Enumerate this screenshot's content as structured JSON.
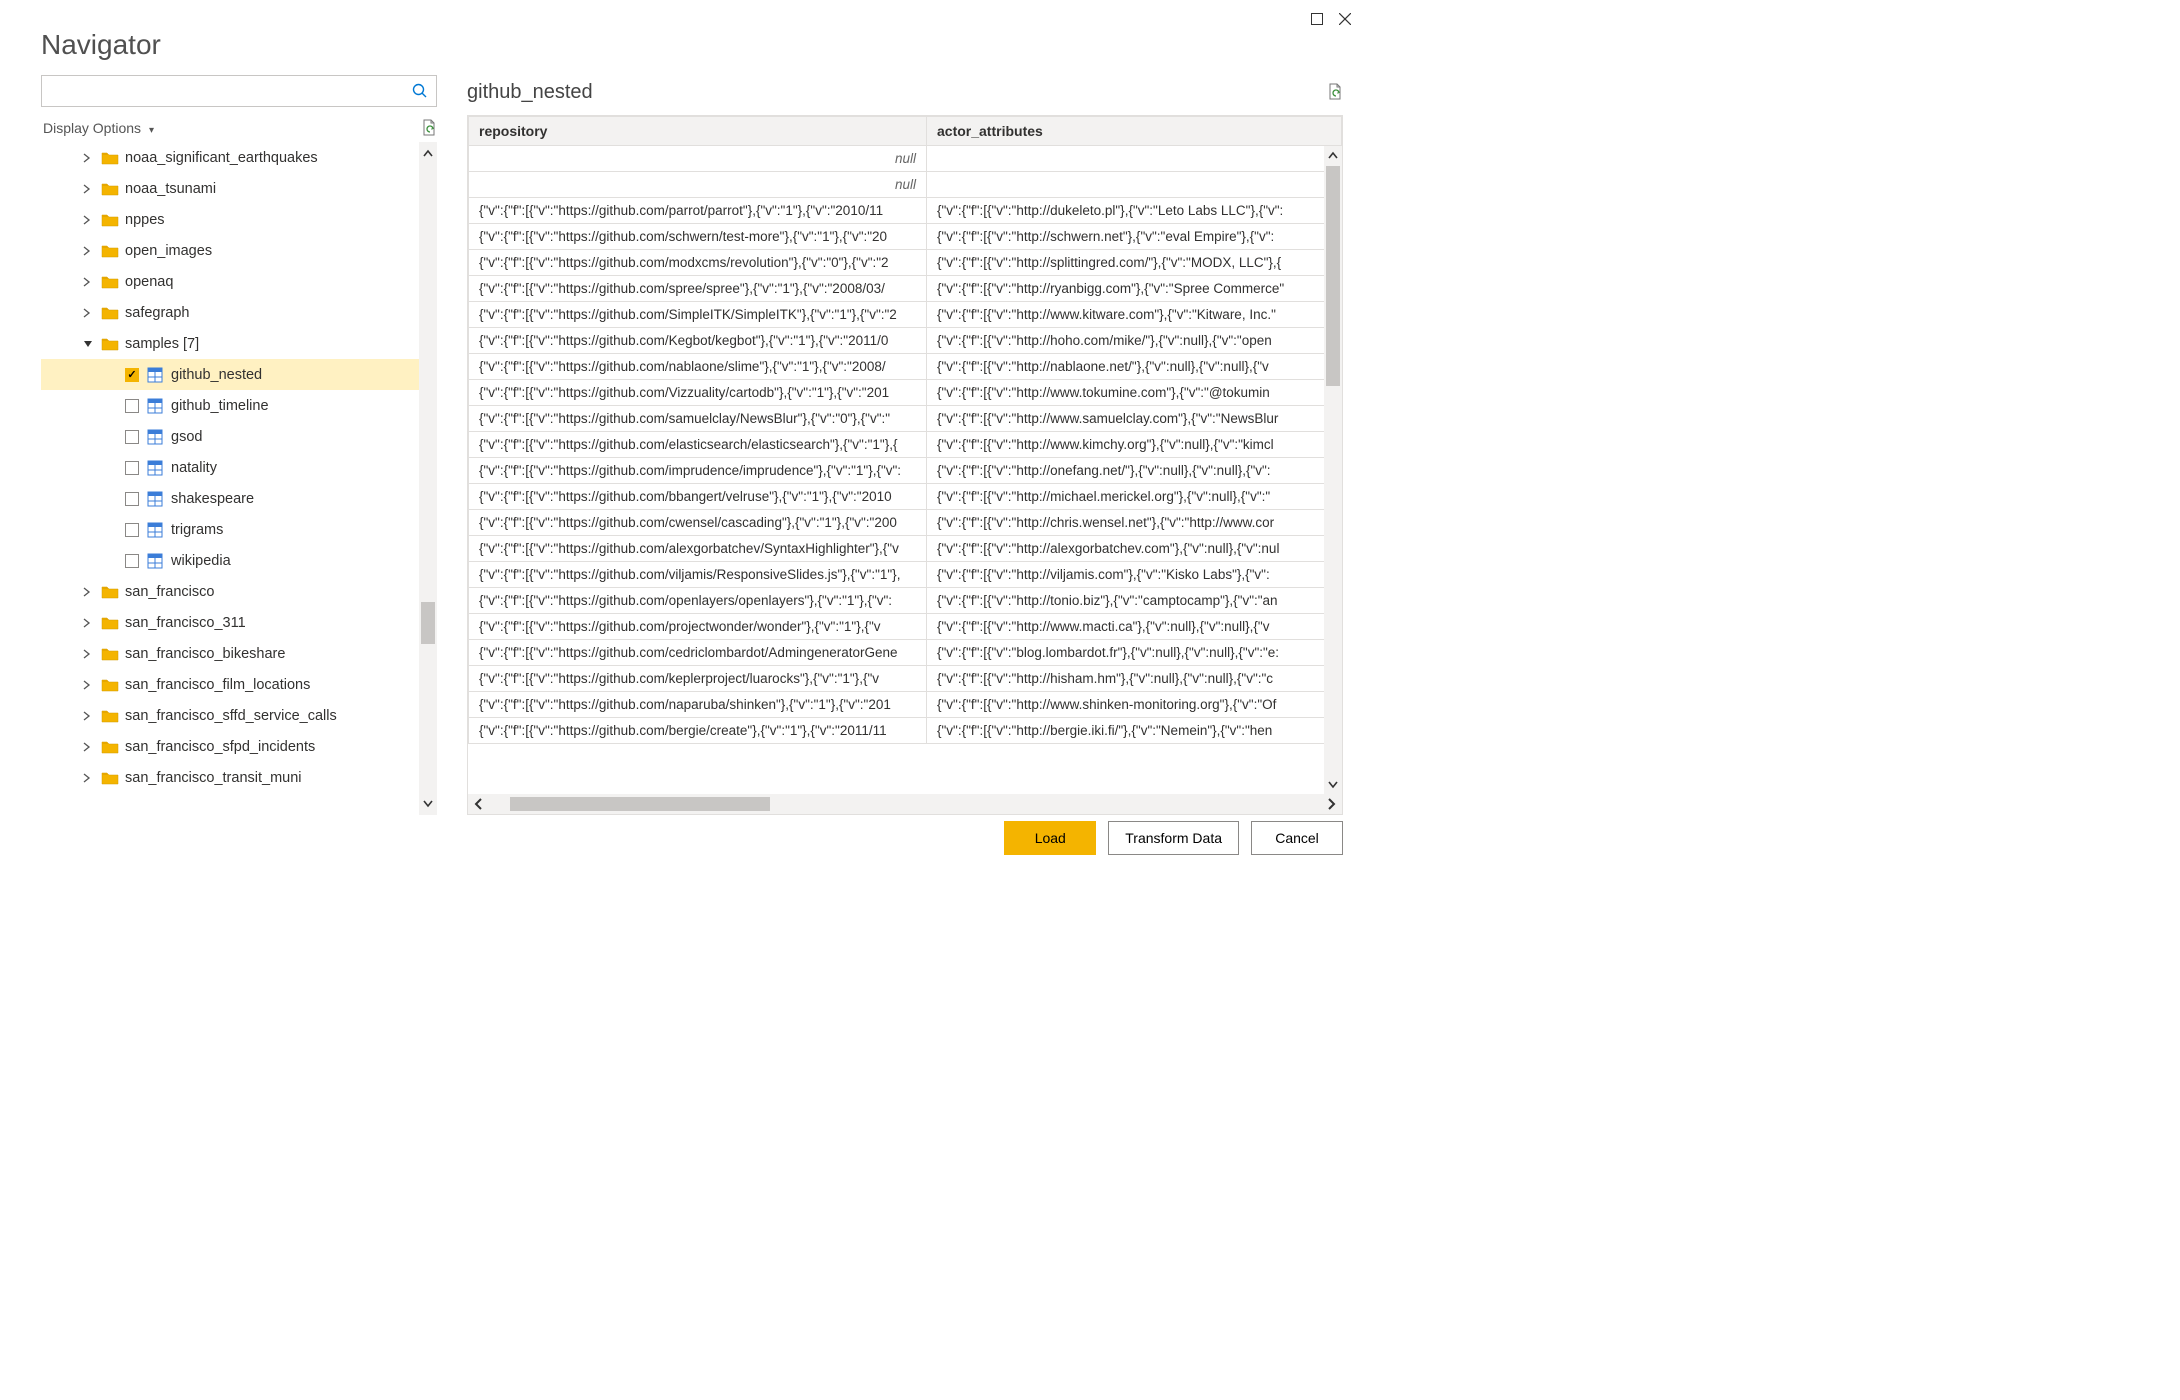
{
  "window": {
    "title": "Navigator"
  },
  "search": {
    "placeholder": ""
  },
  "displayOptions": {
    "label": "Display Options"
  },
  "tree": {
    "items": [
      {
        "type": "folder",
        "level": 1,
        "label": "noaa_significant_earthquakes",
        "truncated": true
      },
      {
        "type": "folder",
        "level": 1,
        "label": "noaa_tsunami"
      },
      {
        "type": "folder",
        "level": 1,
        "label": "nppes"
      },
      {
        "type": "folder",
        "level": 1,
        "label": "open_images"
      },
      {
        "type": "folder",
        "level": 1,
        "label": "openaq"
      },
      {
        "type": "folder",
        "level": 1,
        "label": "safegraph"
      },
      {
        "type": "folder",
        "level": 1,
        "label": "samples [7]",
        "expanded": true
      },
      {
        "type": "table",
        "level": 2,
        "label": "github_nested",
        "checked": true,
        "selected": true
      },
      {
        "type": "table",
        "level": 2,
        "label": "github_timeline"
      },
      {
        "type": "table",
        "level": 2,
        "label": "gsod"
      },
      {
        "type": "table",
        "level": 2,
        "label": "natality"
      },
      {
        "type": "table",
        "level": 2,
        "label": "shakespeare"
      },
      {
        "type": "table",
        "level": 2,
        "label": "trigrams"
      },
      {
        "type": "table",
        "level": 2,
        "label": "wikipedia"
      },
      {
        "type": "folder",
        "level": 1,
        "label": "san_francisco"
      },
      {
        "type": "folder",
        "level": 1,
        "label": "san_francisco_311"
      },
      {
        "type": "folder",
        "level": 1,
        "label": "san_francisco_bikeshare"
      },
      {
        "type": "folder",
        "level": 1,
        "label": "san_francisco_film_locations"
      },
      {
        "type": "folder",
        "level": 1,
        "label": "san_francisco_sffd_service_calls"
      },
      {
        "type": "folder",
        "level": 1,
        "label": "san_francisco_sfpd_incidents"
      },
      {
        "type": "folder",
        "level": 1,
        "label": "san_francisco_transit_muni",
        "truncated": true
      }
    ]
  },
  "preview": {
    "title": "github_nested",
    "columns": [
      "repository",
      "actor_attributes"
    ],
    "rows": [
      {
        "repository": "null",
        "actor_attributes": "",
        "null_rep": true
      },
      {
        "repository": "null",
        "actor_attributes": "",
        "null_rep": true
      },
      {
        "repository": "{\"v\":{\"f\":[{\"v\":\"https://github.com/parrot/parrot\"},{\"v\":\"1\"},{\"v\":\"2010/11",
        "actor_attributes": "{\"v\":{\"f\":[{\"v\":\"http://dukeleto.pl\"},{\"v\":\"Leto Labs LLC\"},{\"v\":"
      },
      {
        "repository": "{\"v\":{\"f\":[{\"v\":\"https://github.com/schwern/test-more\"},{\"v\":\"1\"},{\"v\":\"20",
        "actor_attributes": "{\"v\":{\"f\":[{\"v\":\"http://schwern.net\"},{\"v\":\"eval Empire\"},{\"v\":"
      },
      {
        "repository": "{\"v\":{\"f\":[{\"v\":\"https://github.com/modxcms/revolution\"},{\"v\":\"0\"},{\"v\":\"2",
        "actor_attributes": "{\"v\":{\"f\":[{\"v\":\"http://splittingred.com/\"},{\"v\":\"MODX, LLC\"},{"
      },
      {
        "repository": "{\"v\":{\"f\":[{\"v\":\"https://github.com/spree/spree\"},{\"v\":\"1\"},{\"v\":\"2008/03/",
        "actor_attributes": "{\"v\":{\"f\":[{\"v\":\"http://ryanbigg.com\"},{\"v\":\"Spree Commerce\""
      },
      {
        "repository": "{\"v\":{\"f\":[{\"v\":\"https://github.com/SimpleITK/SimpleITK\"},{\"v\":\"1\"},{\"v\":\"2",
        "actor_attributes": "{\"v\":{\"f\":[{\"v\":\"http://www.kitware.com\"},{\"v\":\"Kitware, Inc.\""
      },
      {
        "repository": "{\"v\":{\"f\":[{\"v\":\"https://github.com/Kegbot/kegbot\"},{\"v\":\"1\"},{\"v\":\"2011/0",
        "actor_attributes": "{\"v\":{\"f\":[{\"v\":\"http://hoho.com/mike/\"},{\"v\":null},{\"v\":\"open"
      },
      {
        "repository": "{\"v\":{\"f\":[{\"v\":\"https://github.com/nablaone/slime\"},{\"v\":\"1\"},{\"v\":\"2008/",
        "actor_attributes": "{\"v\":{\"f\":[{\"v\":\"http://nablaone.net/\"},{\"v\":null},{\"v\":null},{\"v"
      },
      {
        "repository": "{\"v\":{\"f\":[{\"v\":\"https://github.com/Vizzuality/cartodb\"},{\"v\":\"1\"},{\"v\":\"201",
        "actor_attributes": "{\"v\":{\"f\":[{\"v\":\"http://www.tokumine.com\"},{\"v\":\"@tokumin"
      },
      {
        "repository": "{\"v\":{\"f\":[{\"v\":\"https://github.com/samuelclay/NewsBlur\"},{\"v\":\"0\"},{\"v\":\"",
        "actor_attributes": "{\"v\":{\"f\":[{\"v\":\"http://www.samuelclay.com\"},{\"v\":\"NewsBlur"
      },
      {
        "repository": "{\"v\":{\"f\":[{\"v\":\"https://github.com/elasticsearch/elasticsearch\"},{\"v\":\"1\"},{",
        "actor_attributes": "{\"v\":{\"f\":[{\"v\":\"http://www.kimchy.org\"},{\"v\":null},{\"v\":\"kimcl"
      },
      {
        "repository": "{\"v\":{\"f\":[{\"v\":\"https://github.com/imprudence/imprudence\"},{\"v\":\"1\"},{\"v\":",
        "actor_attributes": "{\"v\":{\"f\":[{\"v\":\"http://onefang.net/\"},{\"v\":null},{\"v\":null},{\"v\":"
      },
      {
        "repository": "{\"v\":{\"f\":[{\"v\":\"https://github.com/bbangert/velruse\"},{\"v\":\"1\"},{\"v\":\"2010",
        "actor_attributes": "{\"v\":{\"f\":[{\"v\":\"http://michael.merickel.org\"},{\"v\":null},{\"v\":\""
      },
      {
        "repository": "{\"v\":{\"f\":[{\"v\":\"https://github.com/cwensel/cascading\"},{\"v\":\"1\"},{\"v\":\"200",
        "actor_attributes": "{\"v\":{\"f\":[{\"v\":\"http://chris.wensel.net\"},{\"v\":\"http://www.cor"
      },
      {
        "repository": "{\"v\":{\"f\":[{\"v\":\"https://github.com/alexgorbatchev/SyntaxHighlighter\"},{\"v",
        "actor_attributes": "{\"v\":{\"f\":[{\"v\":\"http://alexgorbatchev.com\"},{\"v\":null},{\"v\":nul"
      },
      {
        "repository": "{\"v\":{\"f\":[{\"v\":\"https://github.com/viljamis/ResponsiveSlides.js\"},{\"v\":\"1\"},",
        "actor_attributes": "{\"v\":{\"f\":[{\"v\":\"http://viljamis.com\"},{\"v\":\"Kisko Labs\"},{\"v\":"
      },
      {
        "repository": "{\"v\":{\"f\":[{\"v\":\"https://github.com/openlayers/openlayers\"},{\"v\":\"1\"},{\"v\":",
        "actor_attributes": "{\"v\":{\"f\":[{\"v\":\"http://tonio.biz\"},{\"v\":\"camptocamp\"},{\"v\":\"an"
      },
      {
        "repository": "{\"v\":{\"f\":[{\"v\":\"https://github.com/projectwonder/wonder\"},{\"v\":\"1\"},{\"v",
        "actor_attributes": "{\"v\":{\"f\":[{\"v\":\"http://www.macti.ca\"},{\"v\":null},{\"v\":null},{\"v"
      },
      {
        "repository": "{\"v\":{\"f\":[{\"v\":\"https://github.com/cedriclombardot/AdmingeneratorGene",
        "actor_attributes": "{\"v\":{\"f\":[{\"v\":\"blog.lombardot.fr\"},{\"v\":null},{\"v\":null},{\"v\":\"e:"
      },
      {
        "repository": "{\"v\":{\"f\":[{\"v\":\"https://github.com/keplerproject/luarocks\"},{\"v\":\"1\"},{\"v",
        "actor_attributes": "{\"v\":{\"f\":[{\"v\":\"http://hisham.hm\"},{\"v\":null},{\"v\":null},{\"v\":\"c"
      },
      {
        "repository": "{\"v\":{\"f\":[{\"v\":\"https://github.com/naparuba/shinken\"},{\"v\":\"1\"},{\"v\":\"201",
        "actor_attributes": "{\"v\":{\"f\":[{\"v\":\"http://www.shinken-monitoring.org\"},{\"v\":\"Of"
      },
      {
        "repository": "{\"v\":{\"f\":[{\"v\":\"https://github.com/bergie/create\"},{\"v\":\"1\"},{\"v\":\"2011/11",
        "actor_attributes": "{\"v\":{\"f\":[{\"v\":\"http://bergie.iki.fi/\"},{\"v\":\"Nemein\"},{\"v\":\"hen"
      }
    ]
  },
  "buttons": {
    "load": "Load",
    "transform": "Transform Data",
    "cancel": "Cancel"
  }
}
